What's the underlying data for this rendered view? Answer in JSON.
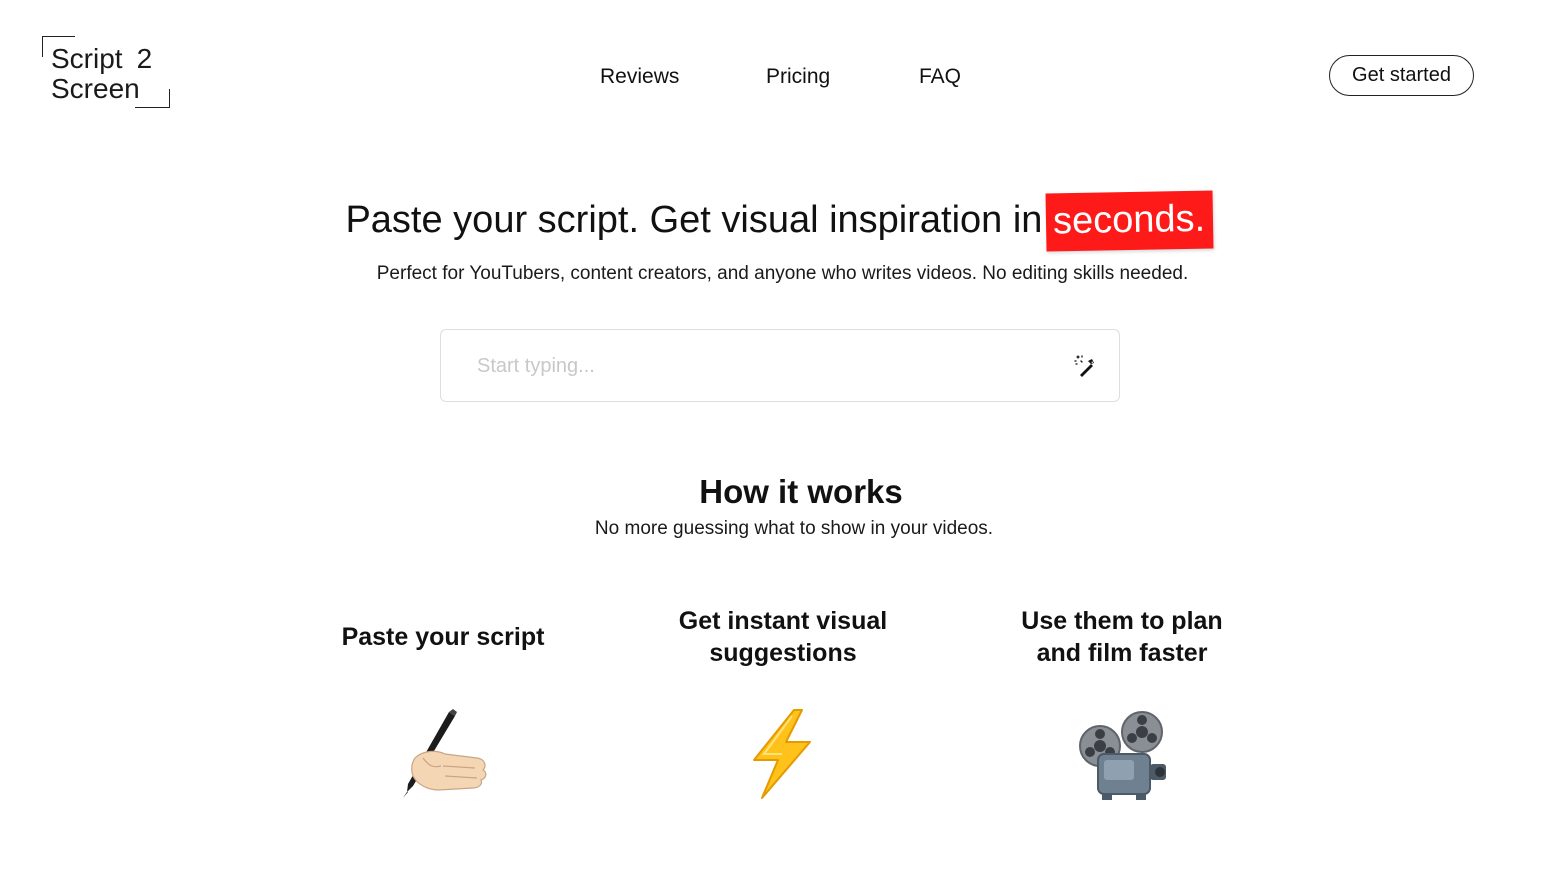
{
  "header": {
    "logo": {
      "line1": "Script",
      "line1_num": "2",
      "line2": "Screen"
    },
    "nav": {
      "reviews": "Reviews",
      "pricing": "Pricing",
      "faq": "FAQ"
    },
    "cta_label": "Get started"
  },
  "hero": {
    "title": "Paste your script. Get visual inspiration in",
    "title_highlight": "seconds.",
    "subtitle": "Perfect for YouTubers, content creators, and anyone who writes videos. No editing skills needed.",
    "input_placeholder": "Start typing...",
    "input_value": ""
  },
  "how": {
    "title": "How it works",
    "subtitle": "No more guessing what to show in your videos.",
    "steps": [
      {
        "title": "Paste your script",
        "icon": "writing-hand-icon"
      },
      {
        "title": "Get instant visual suggestions",
        "icon": "lightning-icon"
      },
      {
        "title": "Use them to plan and film faster",
        "icon": "film-projector-icon"
      }
    ]
  },
  "colors": {
    "highlight": "#ff1a1a",
    "text": "#111111",
    "input_border": "#dedede",
    "placeholder": "#c8c8c8"
  }
}
